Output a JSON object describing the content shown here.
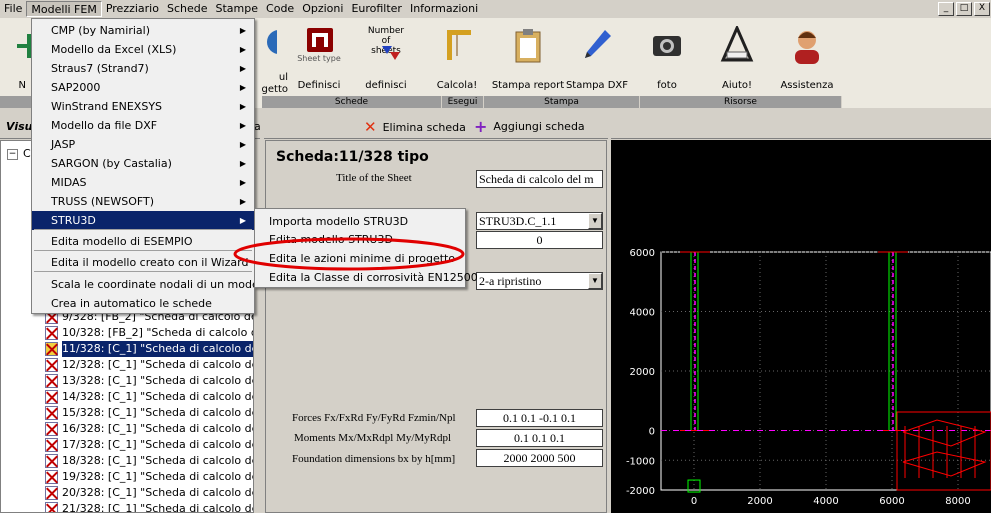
{
  "menubar": {
    "items": [
      "File",
      "Modelli FEM",
      "Prezziario",
      "Schede",
      "Stampe",
      "Code",
      "Opzioni",
      "Eurofilter",
      "Informazioni"
    ]
  },
  "window_buttons": [
    "_",
    "□",
    "X"
  ],
  "toolbar": {
    "buttons": [
      {
        "label": "N",
        "icon": "new-icon"
      },
      {
        "label": "ul\ngetto",
        "icon": "globe-icon"
      },
      {
        "label": "Definisci",
        "icon": "sheet-type-icon",
        "icon_text": "Sheet type"
      },
      {
        "label": "definisci",
        "icon": "number-of-sheets-icon",
        "icon_text": "Number of sheets"
      },
      {
        "label": "Calcola!",
        "icon": "ruler-icon"
      },
      {
        "label": "Stampa report",
        "icon": "clipboard-icon"
      },
      {
        "label": "Stampa DXF",
        "icon": "pencil-icon"
      },
      {
        "label": "foto",
        "icon": "camera-icon"
      },
      {
        "label": "Aiuto!",
        "icon": "help-logo-icon"
      },
      {
        "label": "Assistenza",
        "icon": "support-person-icon"
      }
    ],
    "groups": [
      "Schede",
      "Esegui",
      "Stampa",
      "Risorse"
    ]
  },
  "panel_headers": {
    "left_title": "Visu",
    "left_tail": "a",
    "delete_sheet": "Elimina scheda",
    "add_sheet": "Aggiungi scheda"
  },
  "tree": {
    "root_prefix": "C",
    "rows": [
      {
        "text": "9/328: [FB_2] \"Scheda di calcolo del m",
        "selected": false
      },
      {
        "text": "10/328: [FB_2] \"Scheda di calcolo del m",
        "selected": false
      },
      {
        "text": "11/328: [C_1] \"Scheda di calcolo del m",
        "selected": true
      },
      {
        "text": "12/328: [C_1] \"Scheda di calcolo del m",
        "selected": false
      },
      {
        "text": "13/328: [C_1] \"Scheda di calcolo del m",
        "selected": false
      },
      {
        "text": "14/328: [C_1] \"Scheda di calcolo del m",
        "selected": false
      },
      {
        "text": "15/328: [C_1] \"Scheda di calcolo del m",
        "selected": false
      },
      {
        "text": "16/328: [C_1] \"Scheda di calcolo del m",
        "selected": false
      },
      {
        "text": "17/328: [C_1] \"Scheda di calcolo del m",
        "selected": false
      },
      {
        "text": "18/328: [C_1] \"Scheda di calcolo del m",
        "selected": false
      },
      {
        "text": "19/328: [C_1] \"Scheda di calcolo del m",
        "selected": false
      },
      {
        "text": "20/328: [C_1] \"Scheda di calcolo del m",
        "selected": false
      },
      {
        "text": "21/328: [C_1] \"Scheda di calcolo del m",
        "selected": false
      }
    ]
  },
  "sheet": {
    "heading": "Scheda:11/328 tipo",
    "title_label": "Title of the Sheet",
    "title_value": "Scheda di calcolo del m",
    "model_value": "STRU3D.C_1.1",
    "index_value": "0",
    "corrosivity_value": "2-a ripristino",
    "forces_label": "Forces Fx/FxRd Fy/FyRd Fzmin/Npl",
    "forces_value": "0.1 0.1 -0.1 0.1",
    "moments_label": "Moments Mx/MxRdpl My/MyRdpl",
    "moments_value": "0.1 0.1 0.1",
    "foundation_label": "Foundation dimensions bx by h[mm]",
    "foundation_value": "2000 2000 500"
  },
  "dropdown": {
    "items": [
      {
        "label": "CMP (by Namirial)",
        "submenu": true
      },
      {
        "label": "Modello da Excel (XLS)",
        "submenu": true
      },
      {
        "label": "Straus7 (Strand7)",
        "submenu": true
      },
      {
        "label": "SAP2000",
        "submenu": true
      },
      {
        "label": "WinStrand ENEXSYS",
        "submenu": true
      },
      {
        "label": "Modello da file DXF",
        "submenu": true
      },
      {
        "label": "JASP",
        "submenu": true
      },
      {
        "label": "SARGON (by Castalia)",
        "submenu": true
      },
      {
        "label": "MIDAS",
        "submenu": true
      },
      {
        "label": "TRUSS (NEWSOFT)",
        "submenu": true
      },
      {
        "label": "STRU3D",
        "submenu": true,
        "highlighted": true
      },
      {
        "label": "Edita modello di ESEMPIO",
        "submenu": false
      },
      {
        "label": "Edita il modello creato con il Wizard",
        "submenu": false
      },
      {
        "label": "Scala le coordinate nodali di un modello",
        "submenu": false
      },
      {
        "label": "Crea in automatico le schede",
        "submenu": false
      }
    ],
    "submenu_arrow": "▶"
  },
  "submenu": {
    "items": [
      "Importa modello STRU3D",
      "Edita modello STRU3D",
      "Edita le azioni minime di progetto",
      "Edita la Classe di corrosività EN12500"
    ]
  },
  "plot": {
    "y_ticks": [
      "6000",
      "4000",
      "2000",
      "0",
      "-2000"
    ],
    "y_ticks_shown": [
      "6000",
      "4000",
      "2000",
      "0",
      "-1000",
      "-2000"
    ],
    "x_ticks": [
      "0",
      "2000",
      "4000",
      "6000",
      "8000"
    ],
    "colors": {
      "background": "#000000",
      "members": "#00ff00",
      "dash": "#ff00ff",
      "frame": "#ff0000",
      "axis": "#ffffff"
    }
  },
  "colors": {
    "highlight": "#0a246a",
    "annotation_ellipse": "#e00000"
  }
}
